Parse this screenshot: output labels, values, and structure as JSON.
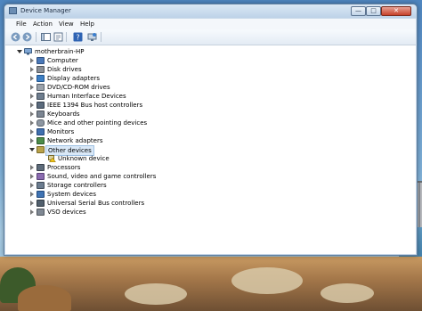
{
  "window": {
    "title": "Device Manager",
    "controls": [
      "—",
      "□",
      "✕"
    ]
  },
  "menu": [
    "File",
    "Action",
    "View",
    "Help"
  ],
  "toolbar_icons": [
    "back-icon",
    "forward-icon",
    "show-hide-tree-icon",
    "properties-icon",
    "help-icon",
    "scan-hardware-icon"
  ],
  "tree": {
    "root": "motherbrain-HP",
    "categories": [
      {
        "label": "Computer",
        "icon": "computer-icon",
        "color": "#4a78b8"
      },
      {
        "label": "Disk drives",
        "icon": "disk-drive-icon",
        "color": "#8a8f96"
      },
      {
        "label": "Display adapters",
        "icon": "display-adapter-icon",
        "color": "#3d7fc4"
      },
      {
        "label": "DVD/CD-ROM drives",
        "icon": "dvd-drive-icon",
        "color": "#9aa2ab"
      },
      {
        "label": "Human Interface Devices",
        "icon": "hid-icon",
        "color": "#6e7d8e"
      },
      {
        "label": "IEEE 1394 Bus host controllers",
        "icon": "ieee1394-icon",
        "color": "#5a6a7c"
      },
      {
        "label": "Keyboards",
        "icon": "keyboard-icon",
        "color": "#7b8592"
      },
      {
        "label": "Mice and other pointing devices",
        "icon": "mouse-icon",
        "color": "#8d96a1"
      },
      {
        "label": "Monitors",
        "icon": "monitor-icon",
        "color": "#3f6fae"
      },
      {
        "label": "Network adapters",
        "icon": "network-adapter-icon",
        "color": "#4c8c4a"
      },
      {
        "label": "Other devices",
        "icon": "other-devices-icon",
        "color": "#b9a24a",
        "expanded": true,
        "selected": true,
        "children": [
          {
            "label": "Unknown device",
            "icon": "unknown-device-warning-icon",
            "color": "#e0b21c"
          }
        ]
      },
      {
        "label": "Processors",
        "icon": "processor-icon",
        "color": "#5d6b7a"
      },
      {
        "label": "Sound, video and game controllers",
        "icon": "sound-icon",
        "color": "#8a6bb0"
      },
      {
        "label": "Storage controllers",
        "icon": "storage-controller-icon",
        "color": "#6b7c8f"
      },
      {
        "label": "System devices",
        "icon": "system-devices-icon",
        "color": "#3f73b3"
      },
      {
        "label": "Universal Serial Bus controllers",
        "icon": "usb-icon",
        "color": "#52606e"
      },
      {
        "label": "VSO devices",
        "icon": "vso-device-icon",
        "color": "#7f8893"
      }
    ]
  }
}
